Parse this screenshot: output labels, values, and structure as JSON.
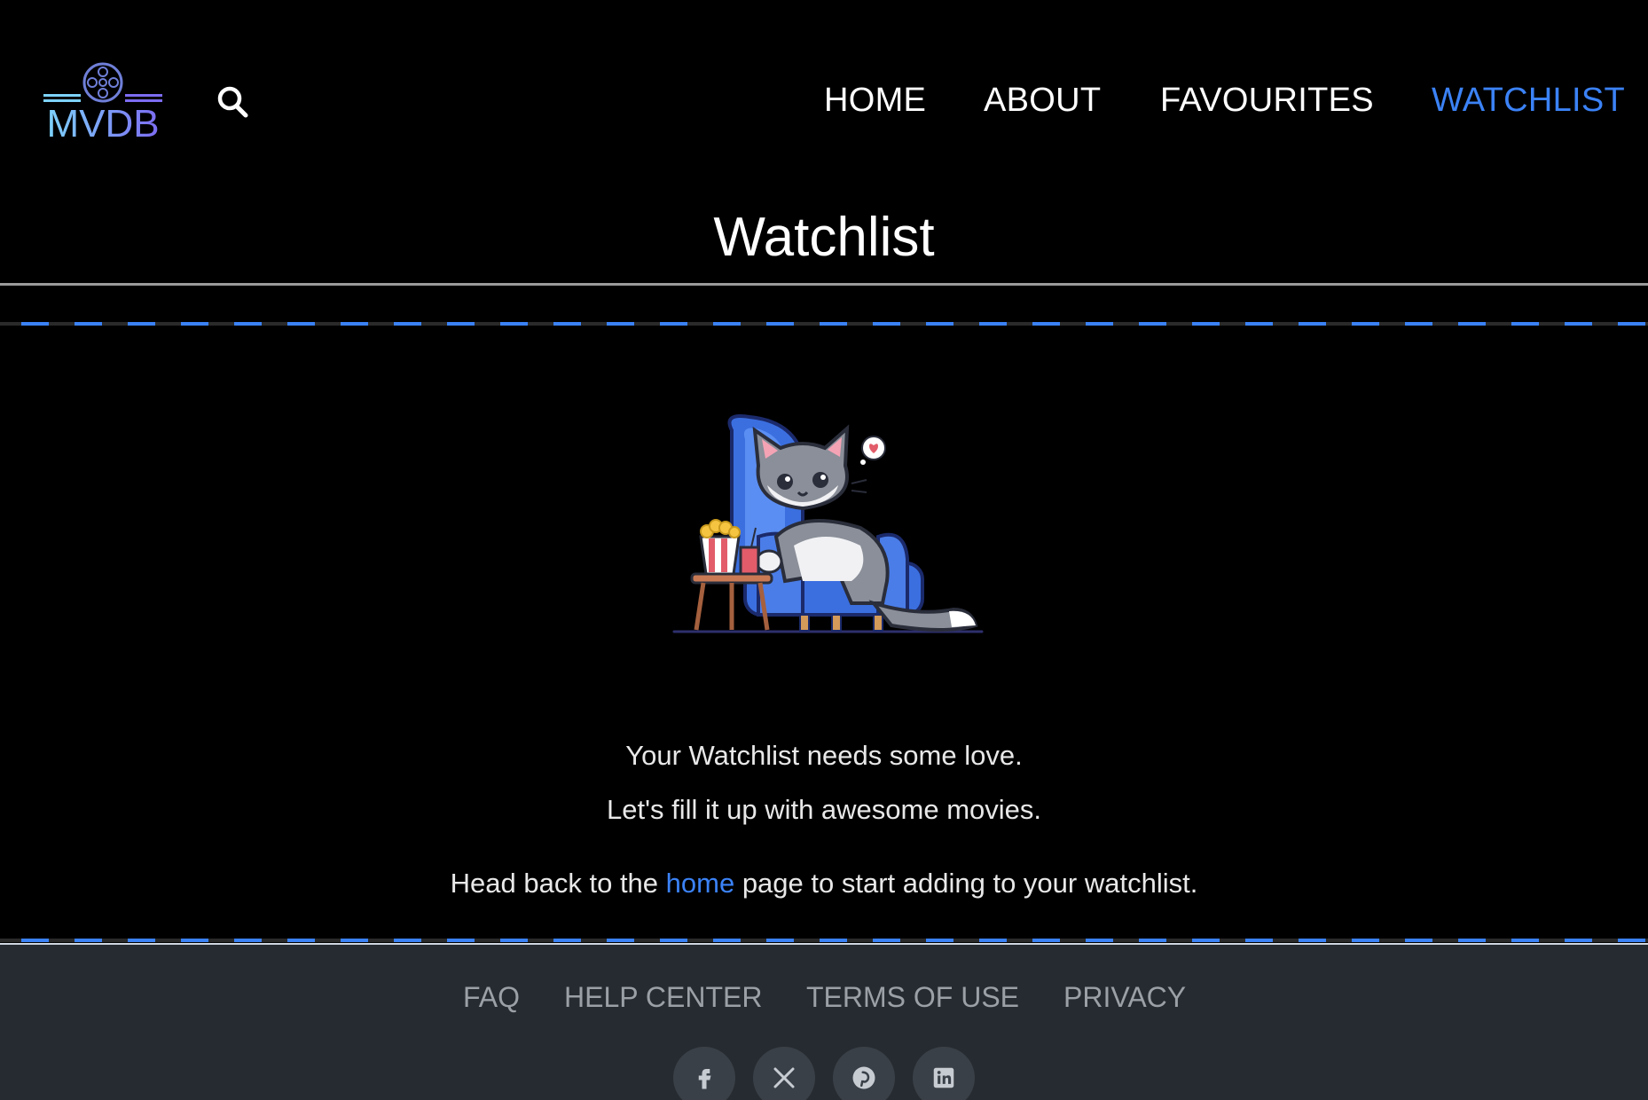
{
  "header": {
    "logo_text": "MVDB",
    "nav": [
      {
        "label": "HOME",
        "active": false
      },
      {
        "label": "ABOUT",
        "active": false
      },
      {
        "label": "FAVOURITES",
        "active": false
      },
      {
        "label": "WATCHLIST",
        "active": true
      }
    ]
  },
  "main": {
    "title": "Watchlist",
    "empty_line_1": "Your Watchlist needs some love.",
    "empty_line_2": "Let's fill it up with awesome movies.",
    "cta_prefix": "Head back to the ",
    "cta_link": "home",
    "cta_suffix": " page to start adding to your watchlist."
  },
  "footer": {
    "links": [
      "FAQ",
      "HELP CENTER",
      "TERMS OF USE",
      "PRIVACY"
    ],
    "socials": [
      "facebook-icon",
      "x-icon",
      "pinterest-icon",
      "linkedin-icon"
    ]
  },
  "colors": {
    "accent": "#3b82f6",
    "background": "#000000",
    "footer_bg": "#262b31"
  }
}
